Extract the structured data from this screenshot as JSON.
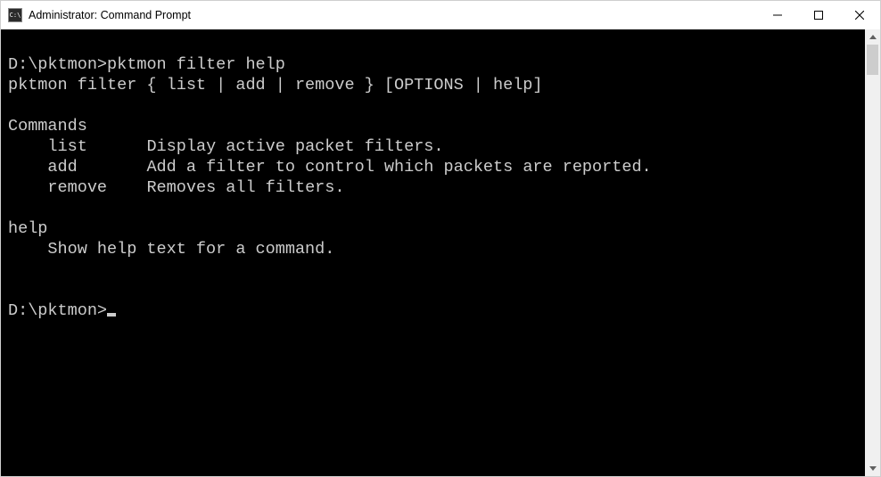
{
  "window": {
    "title": "Administrator: Command Prompt",
    "app_icon_text": "C:\\"
  },
  "terminal": {
    "lines": [
      {
        "type": "prompt_cmd",
        "prompt": "D:\\pktmon>",
        "command": "pktmon filter help"
      },
      {
        "type": "text",
        "text": "pktmon filter { list | add | remove } [OPTIONS | help]"
      },
      {
        "type": "blank"
      },
      {
        "type": "text",
        "text": "Commands"
      },
      {
        "type": "cmdrow",
        "name": "list",
        "desc": "Display active packet filters."
      },
      {
        "type": "cmdrow",
        "name": "add",
        "desc": "Add a filter to control which packets are reported."
      },
      {
        "type": "cmdrow",
        "name": "remove",
        "desc": "Removes all filters."
      },
      {
        "type": "blank"
      },
      {
        "type": "text",
        "text": "help"
      },
      {
        "type": "indent",
        "text": "Show help text for a command."
      },
      {
        "type": "blank"
      },
      {
        "type": "blank"
      },
      {
        "type": "prompt_only",
        "prompt": "D:\\pktmon>"
      }
    ]
  }
}
